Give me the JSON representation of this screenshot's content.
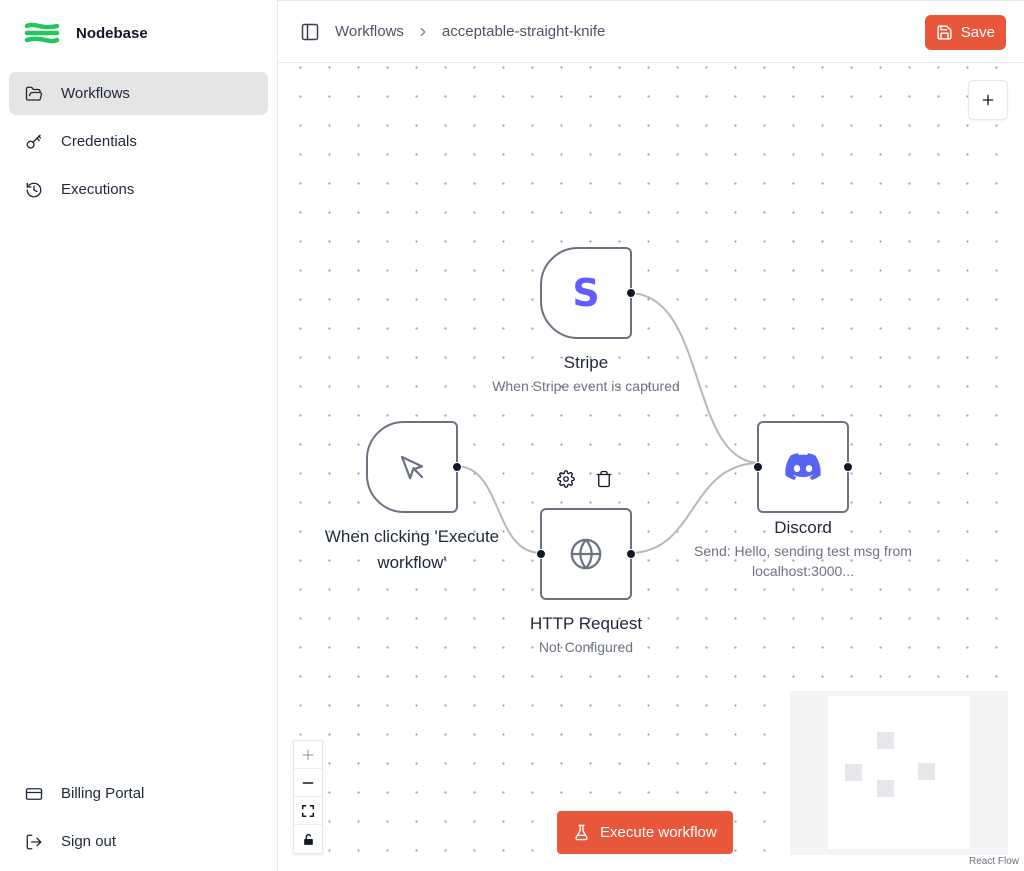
{
  "sidebar": {
    "brand": "Nodebase",
    "nav": [
      {
        "label": "Workflows",
        "icon": "folder-open-icon",
        "active": true
      },
      {
        "label": "Credentials",
        "icon": "key-icon",
        "active": false
      },
      {
        "label": "Executions",
        "icon": "history-icon",
        "active": false
      }
    ],
    "bottom": [
      {
        "label": "Billing Portal",
        "icon": "credit-card-icon"
      },
      {
        "label": "Sign out",
        "icon": "log-out-icon"
      }
    ]
  },
  "header": {
    "breadcrumbs": [
      "Workflows",
      "acceptable-straight-knife"
    ],
    "save_label": "Save"
  },
  "canvas": {
    "nodes": [
      {
        "id": "manual",
        "title": "When clicking 'Execute workflow'",
        "subtitle": "",
        "icon": "cursor-click-icon"
      },
      {
        "id": "stripe",
        "title": "Stripe",
        "subtitle": "When Stripe event is captured",
        "icon": "stripe-icon"
      },
      {
        "id": "http",
        "title": "HTTP Request",
        "subtitle": "Not Configured",
        "icon": "globe-icon"
      },
      {
        "id": "discord",
        "title": "Discord",
        "subtitle": "Send: Hello, sending test msg from localhost:3000...",
        "icon": "discord-icon"
      }
    ],
    "edges": [
      {
        "from": "manual",
        "to": "http"
      },
      {
        "from": "stripe",
        "to": "discord"
      },
      {
        "from": "http",
        "to": "discord"
      }
    ],
    "execute_label": "Execute workflow",
    "attribution": "React Flow"
  },
  "colors": {
    "accent": "#e8573a",
    "brand_green": "#22c55e",
    "stripe": "#635bff",
    "discord": "#5865f2"
  }
}
